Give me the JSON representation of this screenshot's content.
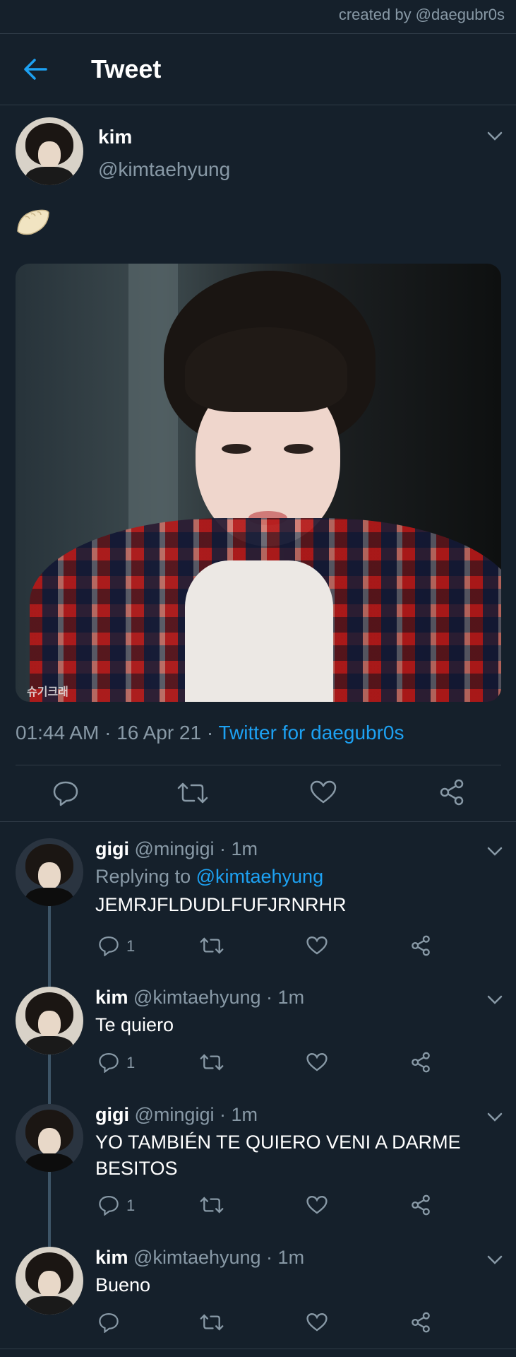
{
  "credit": "created by @daegubr0s",
  "header": {
    "title": "Tweet"
  },
  "tweet": {
    "name": "kim",
    "handle": "@kimtaehyung",
    "emoji": "dumpling",
    "media_watermark": "슈기크래",
    "time": "01:44 AM",
    "date": "16 Apr 21",
    "separator": " · ",
    "source": "Twitter for daegubr0s"
  },
  "replies": [
    {
      "name": "gigi",
      "handle": "@mingigi",
      "time": "1m",
      "replying_prefix": "Replying to ",
      "replying_to": "@kimtaehyung",
      "text": "JEMRJFLDUDLFUFJRNRHR",
      "reply_count": "1"
    },
    {
      "name": "kim",
      "handle": "@kimtaehyung",
      "time": "1m",
      "text": "Te quiero",
      "reply_count": "1"
    },
    {
      "name": "gigi",
      "handle": "@mingigi",
      "time": "1m",
      "text": "YO TAMBIÉN TE QUIERO VENI A DARME BESITOS",
      "reply_count": "1"
    },
    {
      "name": "kim",
      "handle": "@kimtaehyung",
      "time": "1m",
      "text": "Bueno",
      "reply_count": ""
    }
  ],
  "icons": {
    "back": "arrow-left-icon",
    "reply": "speech-bubble-icon",
    "retweet": "retweet-icon",
    "like": "heart-icon",
    "share": "share-icon",
    "more": "chevron-down-icon"
  },
  "colors": {
    "background": "#15202b",
    "accent": "#1da1f2",
    "muted": "#8899a6",
    "divider": "#2f3b47"
  }
}
